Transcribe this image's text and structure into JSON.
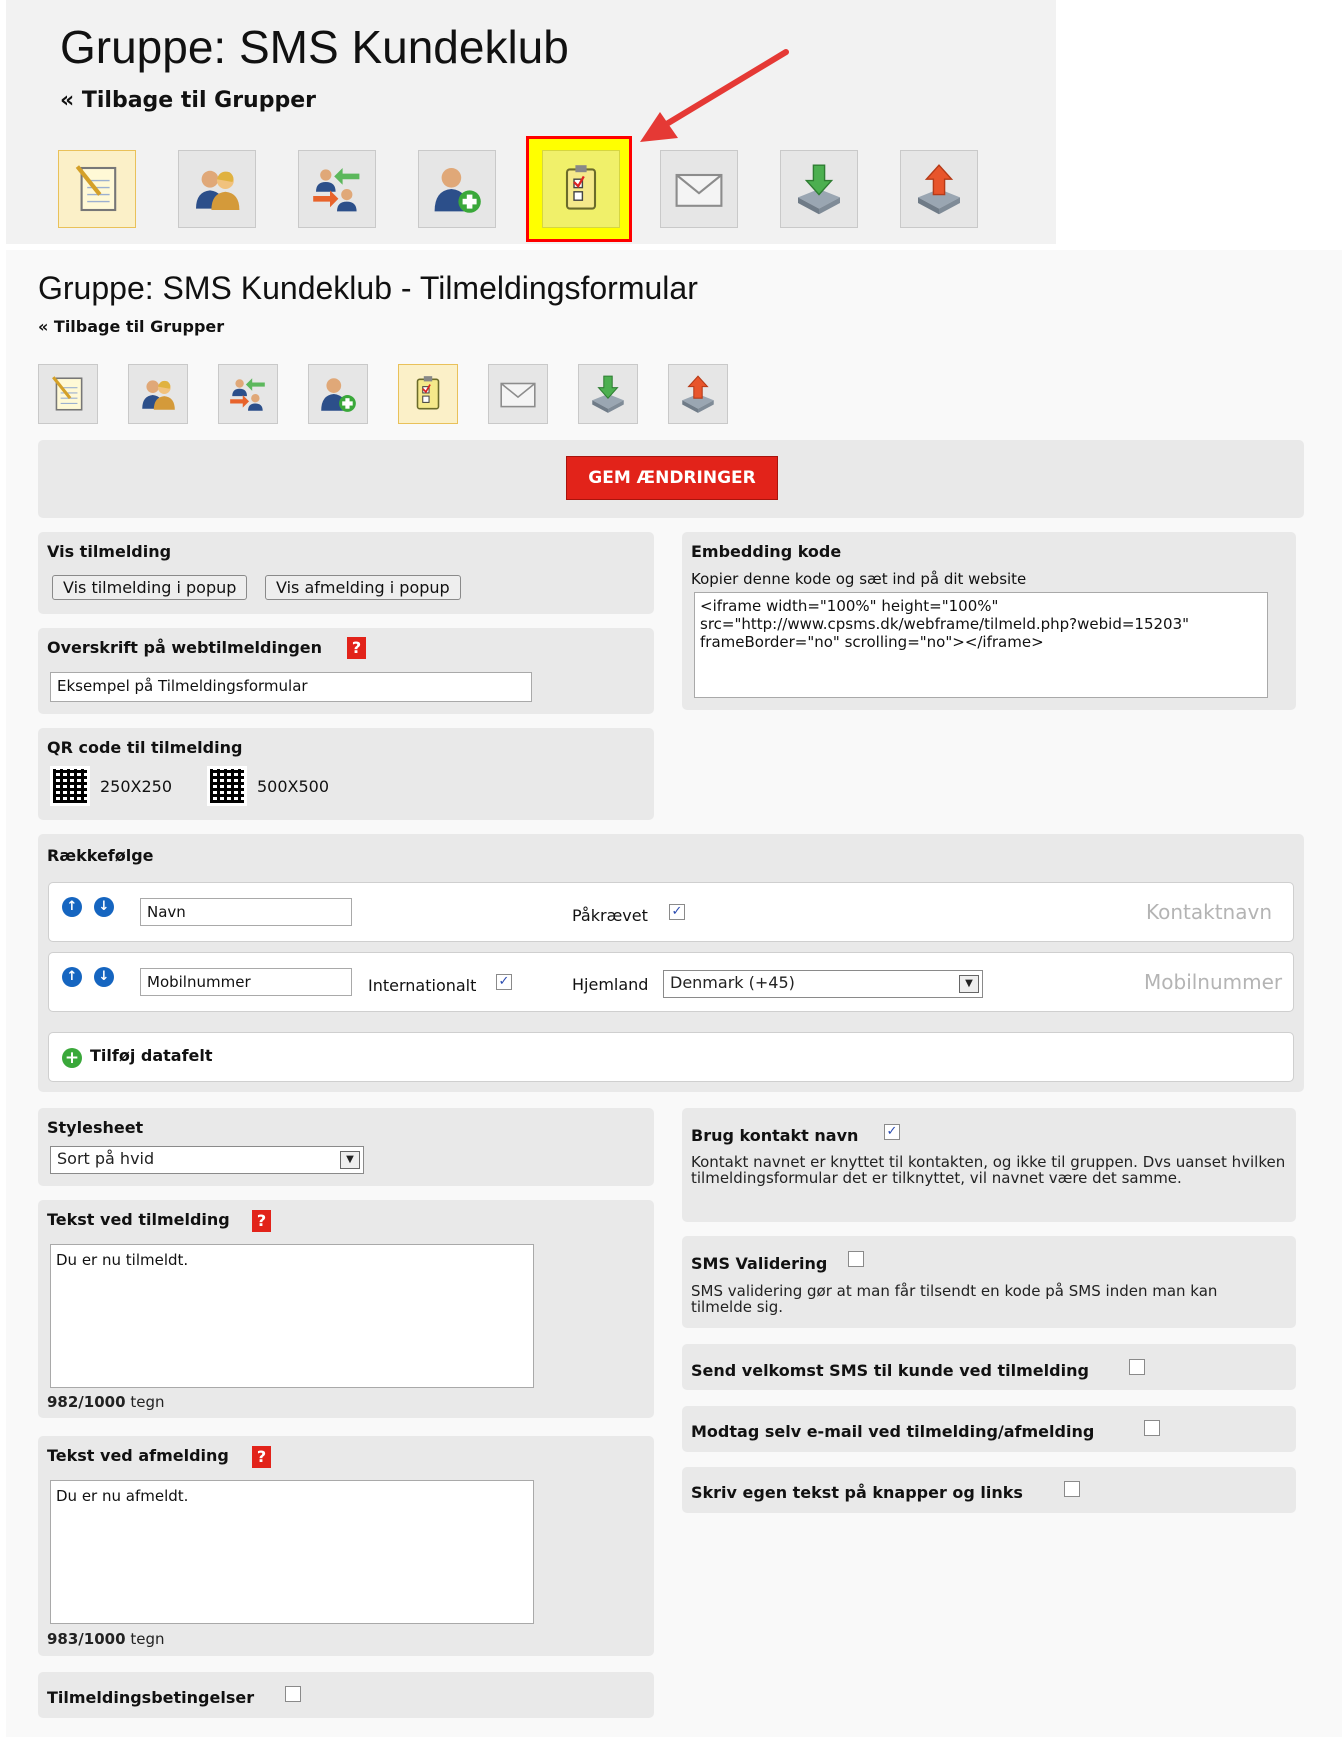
{
  "banner": {
    "title": "Gruppe: SMS Kundeklub",
    "back_link": "« Tilbage til Grupper",
    "icons": [
      "notepad-icon",
      "contacts-icon",
      "transfer-contacts-icon",
      "add-contact-icon",
      "signup-form-icon",
      "envelope-icon",
      "import-icon",
      "export-icon"
    ]
  },
  "page": {
    "title": "Gruppe: SMS Kundeklub - Tilmeldingsformular",
    "back_link": "« Tilbage til Grupper",
    "save_button": "GEM ÆNDRINGER"
  },
  "vis_tilmelding": {
    "label": "Vis tilmelding",
    "btn_popup_signup": "Vis tilmelding i popup",
    "btn_popup_unsub": "Vis afmelding i popup"
  },
  "overskrift": {
    "label": "Overskrift på webtilmeldingen",
    "value": "Eksempel på Tilmeldingsformular"
  },
  "qr": {
    "label": "QR code til tilmelding",
    "size1": "250X250",
    "size2": "500X500"
  },
  "embedding": {
    "label": "Embedding kode",
    "hint": "Kopier denne kode og sæt ind på dit website",
    "code": "<iframe width=\"100%\" height=\"100%\"\nsrc=\"http://www.cpsms.dk/webframe/tilmeld.php?webid=15203\"\nframeBorder=\"no\" scrolling=\"no\"></iframe>"
  },
  "raekkefolge": {
    "label": "Rækkefølge",
    "rows": [
      {
        "value": "Navn",
        "required_label": "Påkrævet",
        "required": true,
        "type_label": "Kontaktnavn"
      },
      {
        "value": "Mobilnummer",
        "intl_label": "Internationalt",
        "intl": true,
        "country_label": "Hjemland",
        "country": "Denmark (+45)",
        "type_label": "Mobilnummer"
      }
    ],
    "add_field": "Tilføj datafelt"
  },
  "stylesheet": {
    "label": "Stylesheet",
    "selected": "Sort på hvid"
  },
  "tekst_tilmelding": {
    "label": "Tekst ved tilmelding",
    "value": "Du er nu tilmeldt.",
    "count": "982/1000",
    "unit": "tegn"
  },
  "tekst_afmelding": {
    "label": "Tekst ved afmelding",
    "value": "Du er nu afmeldt.",
    "count": "983/1000",
    "unit": "tegn"
  },
  "betingelser": {
    "label": "Tilmeldingsbetingelser",
    "checked": false
  },
  "options": {
    "kontakt_navn": {
      "label": "Brug kontakt navn",
      "checked": true,
      "desc": "Kontakt navnet er knyttet til kontakten, og ikke til gruppen. Dvs uanset hvilken tilmeldingsformular det er tilknyttet, vil navnet være det samme."
    },
    "sms_validering": {
      "label": "SMS Validering",
      "checked": false,
      "desc": "SMS validering gør at man får tilsendt en kode på SMS inden man kan tilmelde sig."
    },
    "velkomst_sms": {
      "label": "Send velkomst SMS til kunde ved tilmelding",
      "checked": false
    },
    "email": {
      "label": "Modtag selv e-mail ved tilmelding/afmelding",
      "checked": false
    },
    "egen_tekst": {
      "label": "Skriv egen tekst på knapper og links",
      "checked": false
    }
  },
  "colors": {
    "save_red": "#e2231a",
    "highlight_yellow": "#ffff00",
    "highlight_border": "#ff0000",
    "arrow_red": "#e53935",
    "panel_grey": "#e9e9e9",
    "icon_blue": "#1565c0",
    "add_green": "#3aa83a"
  }
}
